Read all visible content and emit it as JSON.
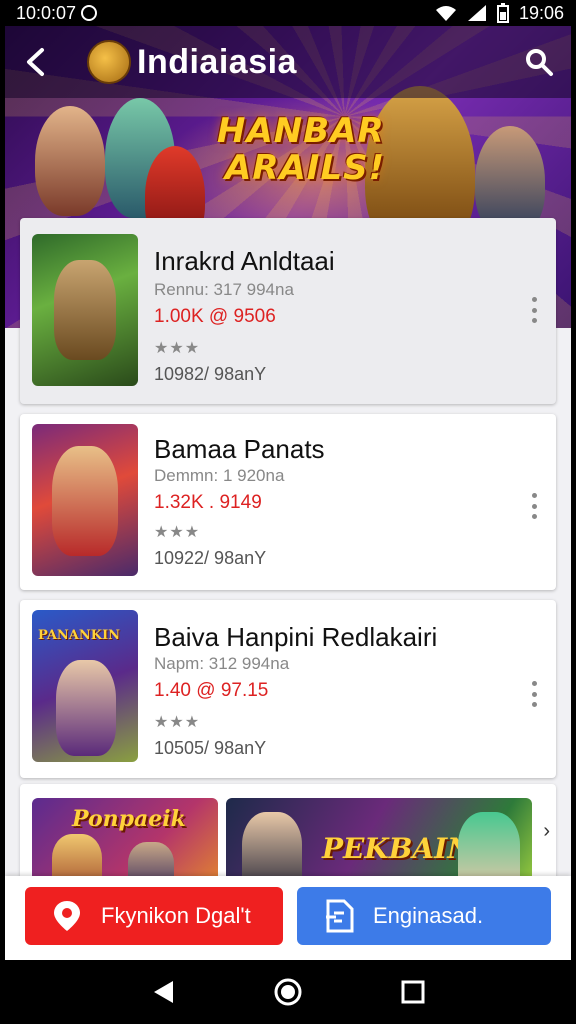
{
  "status_bar": {
    "left_time": "10:0:07",
    "right_time": "19:06"
  },
  "app_bar": {
    "title": "Indiaiasia"
  },
  "hero": {
    "line1": "HANBAR",
    "line2": "ARAILS!"
  },
  "cards": [
    {
      "title": "Inrakrd Anldtaai",
      "sub": "Rennu: 317 994na",
      "price": "1.00K @ 9506",
      "stars": "★★★",
      "count": "10982/ 98anY"
    },
    {
      "title": "Bamaa Panats",
      "sub": "Demmn: 1 920na",
      "price": "1.32K . 9149",
      "stars": "★★★",
      "count": "10922/ 98anY"
    },
    {
      "title": "Baiva Hanpini Redlakairi",
      "sub": "Napm: 312 994na",
      "price": "1.40 @ 97.15",
      "stars": "★★★",
      "count": "10505/ 98anY"
    }
  ],
  "banners": [
    {
      "label": "Ponpaeik"
    },
    {
      "label": "PEKBAIN"
    }
  ],
  "bottom_bar": {
    "primary_label": "Fkynikon Dgal't",
    "secondary_label": "Enginasad."
  },
  "colors": {
    "primary": "#ef2020",
    "secondary": "#3d7be8",
    "price": "#d22222",
    "hero_bg": "#5b1b8f"
  },
  "icons": {
    "back": "arrow-left-icon",
    "search": "search-icon",
    "more": "more-vert-icon",
    "location": "location-pin-icon",
    "doc": "document-icon"
  }
}
